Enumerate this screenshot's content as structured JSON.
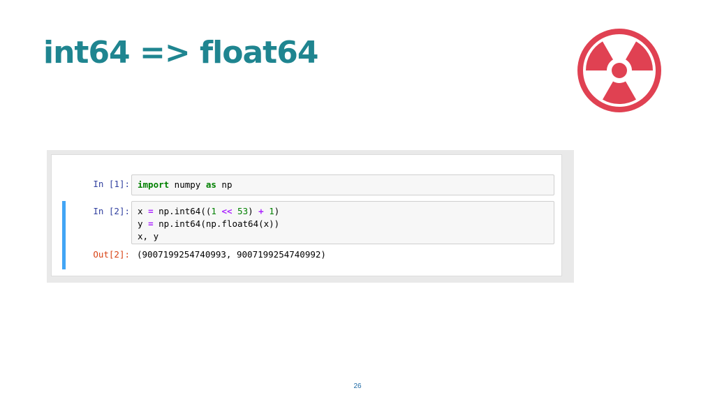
{
  "slide": {
    "title": "int64 => float64",
    "page_number": "26",
    "accent_color": "#1f8590",
    "hazard_icon": "radiation-icon",
    "hazard_color": "#e04152"
  },
  "notebook": {
    "cells": [
      {
        "prompt": "In [1]:",
        "code_tokens": [
          "import",
          " numpy ",
          "as",
          " np"
        ]
      },
      {
        "prompt": "In [2]:",
        "code_lines": [
          [
            "x ",
            "=",
            " np.int64((",
            "1",
            " ",
            "<<",
            " ",
            "53",
            ") ",
            "+",
            " ",
            "1",
            ")"
          ],
          [
            "y ",
            "=",
            " np.int64(np.float64(x))"
          ],
          [
            "x, y"
          ]
        ],
        "output_prompt": "Out[2]:",
        "output": "(9007199254740993, 9007199254740992)"
      }
    ]
  }
}
